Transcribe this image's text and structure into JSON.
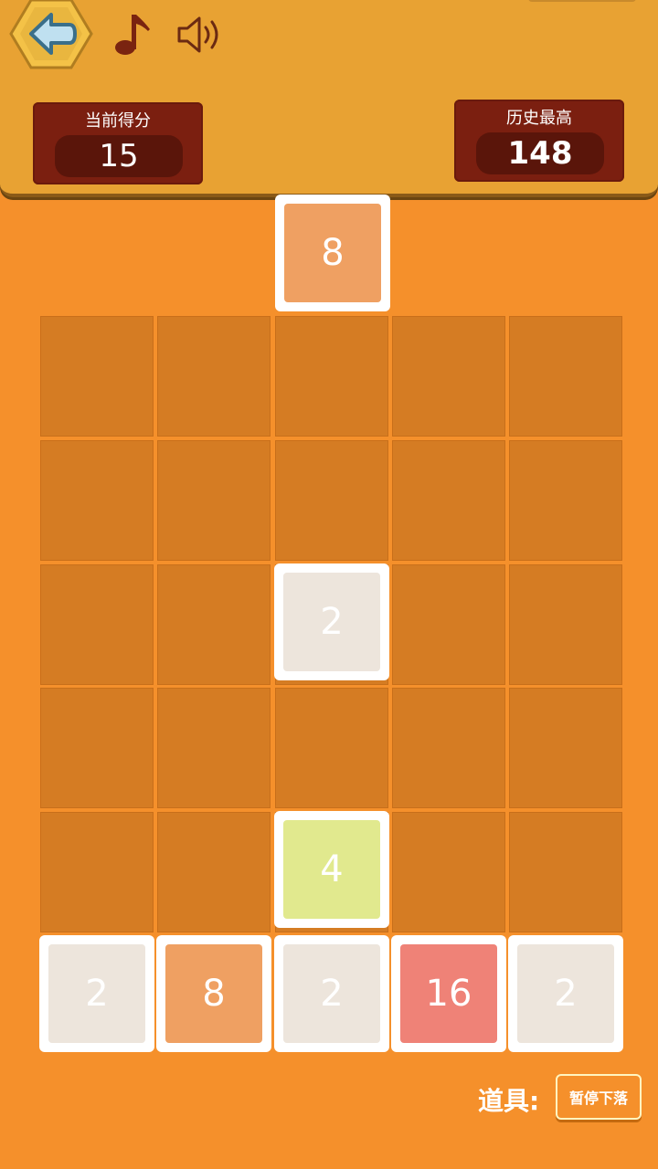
{
  "header": {
    "current_score_label": "当前得分",
    "current_score": "15",
    "best_score_label": "历史最高",
    "best_score": "148"
  },
  "falling_tile": "8",
  "grid": {
    "rows": 5,
    "cols": 5,
    "tiles": [
      {
        "row": 2,
        "col": 2,
        "value": "2"
      },
      {
        "row": 4,
        "col": 2,
        "value": "4"
      },
      {
        "row": 5,
        "col": 0,
        "value": "2"
      },
      {
        "row": 5,
        "col": 1,
        "value": "8"
      },
      {
        "row": 5,
        "col": 2,
        "value": "2"
      },
      {
        "row": 5,
        "col": 3,
        "value": "16"
      },
      {
        "row": 5,
        "col": 4,
        "value": "2"
      }
    ]
  },
  "tools": {
    "label": "道具:",
    "pause_label": "暂停下落"
  },
  "colors": {
    "background": "#f5902b",
    "header": "#e8a233",
    "cell": "#d57c23",
    "tile_2": "#ede5dc",
    "tile_4": "#e1e98e",
    "tile_8": "#efa062",
    "tile_16": "#ef8277"
  },
  "icons": [
    "back-arrow-icon",
    "music-note-icon",
    "speaker-icon"
  ]
}
